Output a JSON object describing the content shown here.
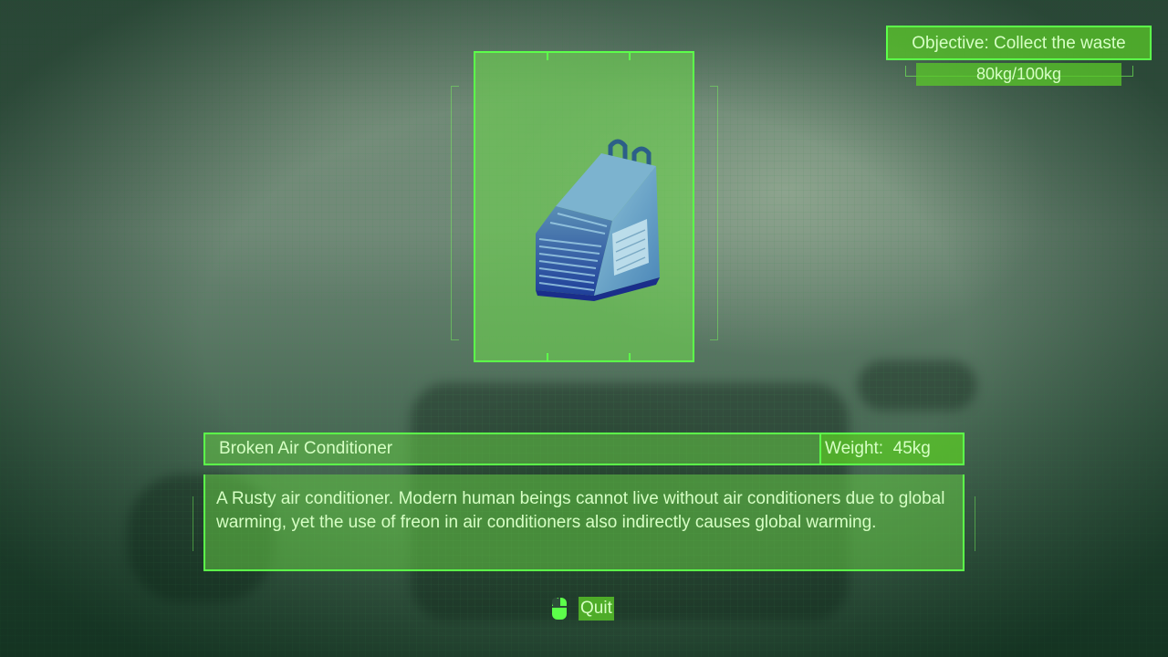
{
  "objective": {
    "text": "Objective: Collect the waste",
    "progress_text": "80kg/100kg"
  },
  "item": {
    "name": "Broken Air Conditioner",
    "weight": "Weight:  45kg",
    "description": "A Rusty air conditioner. Modern human beings cannot live without air conditioners due to global warming, yet the use of freon in air conditioners also indirectly causes global warming.",
    "image_icon": "air-conditioner-icon"
  },
  "controls": {
    "quit_label": "Quit",
    "quit_icon": "mouse-icon"
  },
  "colors": {
    "hud_green": "#5cff4a",
    "hud_fill": "#5ac828",
    "hud_text": "#d6ffc4"
  }
}
